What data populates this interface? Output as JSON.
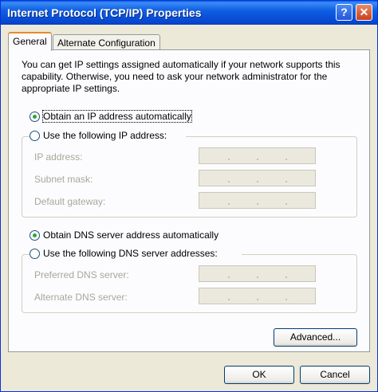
{
  "window": {
    "title": "Internet Protocol (TCP/IP) Properties",
    "help_glyph": "?",
    "close_glyph": "✕"
  },
  "tabs": [
    {
      "label": "General",
      "active": true
    },
    {
      "label": "Alternate Configuration",
      "active": false
    }
  ],
  "description": "You can get IP settings assigned automatically if your network supports this capability. Otherwise, you need to ask your network administrator for the appropriate IP settings.",
  "ip_section": {
    "auto_label": "Obtain an IP address automatically",
    "manual_label": "Use the following IP address:",
    "selected": "auto",
    "fields": [
      {
        "label": "IP address:"
      },
      {
        "label": "Subnet mask:"
      },
      {
        "label": "Default gateway:"
      }
    ]
  },
  "dns_section": {
    "auto_label": "Obtain DNS server address automatically",
    "manual_label": "Use the following DNS server addresses:",
    "selected": "auto",
    "fields": [
      {
        "label": "Preferred DNS server:"
      },
      {
        "label": "Alternate DNS server:"
      }
    ]
  },
  "buttons": {
    "advanced": "Advanced...",
    "ok": "OK",
    "cancel": "Cancel"
  },
  "colors": {
    "title_bar": "#0a5ee8",
    "dialog_bg": "#ece9d8",
    "panel_bg": "#fcfcfe",
    "tab_highlight": "#e68b2c",
    "radio_dot": "#2fa62f",
    "disabled_text": "#a9a79a"
  }
}
